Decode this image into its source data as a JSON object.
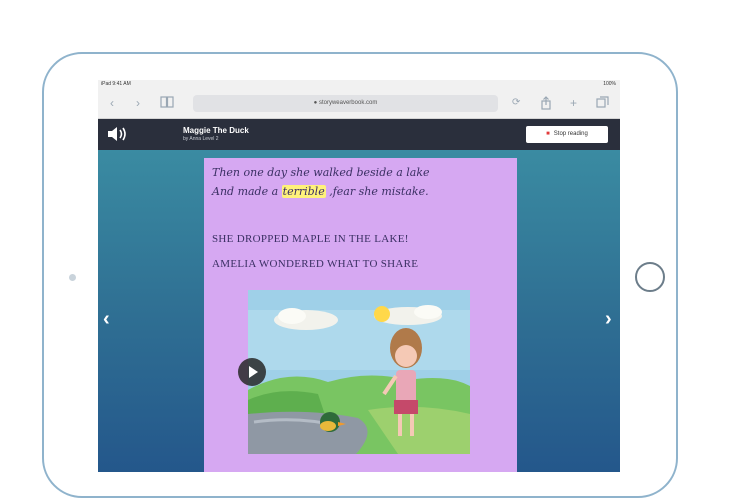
{
  "status_bar": {
    "left": "iPad  9:41 AM",
    "right": "100%"
  },
  "browser": {
    "url": "● storyweaverbook.com",
    "icons": [
      "back-icon",
      "forward-icon",
      "book-icon",
      "refresh-icon",
      "share-icon",
      "add-tab-icon",
      "tabs-icon"
    ]
  },
  "app_header": {
    "title": "Maggie The Duck",
    "subtitle": "by Anna  Level 2",
    "stop_button_label": "Stop reading",
    "accent_color": "#e23a3a",
    "speaker_icon": "speaker-icon"
  },
  "nav": {
    "prev_icon": "chevron-left-icon",
    "next_icon": "chevron-right-icon",
    "prev_glyph": "‹",
    "next_glyph": "›"
  },
  "page": {
    "line1": "Then one day she walked beside a lake",
    "line2_pre": "And made a ",
    "line2_highlight": "terrible",
    "line2_post": " ,fear she mistake.",
    "line3": "SHE DROPPED MAPLE IN THE LAKE!",
    "line4": "AMELIA WONDERED WHAT TO SHARE",
    "background_color": "#d6a8f2",
    "highlight_color": "#fff27a"
  },
  "illustration": {
    "play_icon": "play-icon"
  }
}
